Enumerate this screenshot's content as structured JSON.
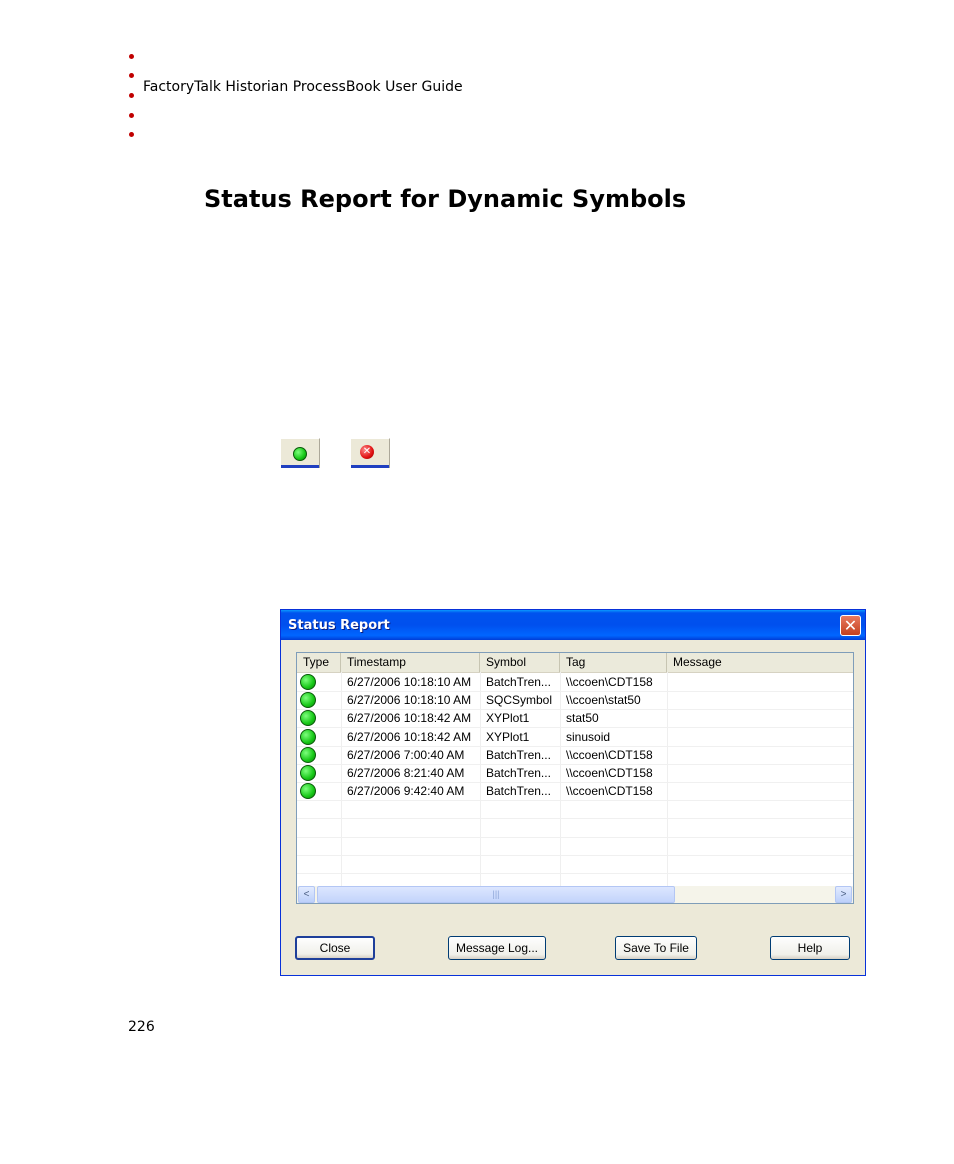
{
  "header": {
    "running_title": "FactoryTalk Historian ProcessBook User Guide"
  },
  "section": {
    "title": "Status Report for Dynamic Symbols"
  },
  "status_icons": {
    "ok_icon": "green-circle-icon",
    "error_icon": "red-x-icon"
  },
  "dialog": {
    "title": "Status Report",
    "close_glyph": "✕",
    "columns": [
      "Type",
      "Timestamp",
      "Symbol",
      "Tag",
      "Message"
    ],
    "rows": [
      {
        "type": "ok",
        "timestamp": "6/27/2006 10:18:10 AM",
        "symbol": "BatchTren...",
        "tag": "\\\\ccoen\\CDT158",
        "message": ""
      },
      {
        "type": "ok",
        "timestamp": "6/27/2006 10:18:10 AM",
        "symbol": "SQCSymbol",
        "tag": "\\\\ccoen\\stat50",
        "message": ""
      },
      {
        "type": "ok",
        "timestamp": "6/27/2006 10:18:42 AM",
        "symbol": "XYPlot1",
        "tag": "stat50",
        "message": ""
      },
      {
        "type": "ok",
        "timestamp": "6/27/2006 10:18:42 AM",
        "symbol": "XYPlot1",
        "tag": "sinusoid",
        "message": ""
      },
      {
        "type": "ok",
        "timestamp": "6/27/2006 7:00:40 AM",
        "symbol": "BatchTren...",
        "tag": "\\\\ccoen\\CDT158",
        "message": ""
      },
      {
        "type": "ok",
        "timestamp": "6/27/2006 8:21:40 AM",
        "symbol": "BatchTren...",
        "tag": "\\\\ccoen\\CDT158",
        "message": ""
      },
      {
        "type": "ok",
        "timestamp": "6/27/2006 9:42:40 AM",
        "symbol": "BatchTren...",
        "tag": "\\\\ccoen\\CDT158",
        "message": ""
      }
    ],
    "scroll_left_glyph": "<",
    "scroll_right_glyph": ">",
    "scroll_thumb_grip": "|||",
    "buttons": {
      "close": "Close",
      "message_log": "Message Log...",
      "save_to_file": "Save To File",
      "help": "Help"
    }
  },
  "footer": {
    "page_number": "226"
  }
}
